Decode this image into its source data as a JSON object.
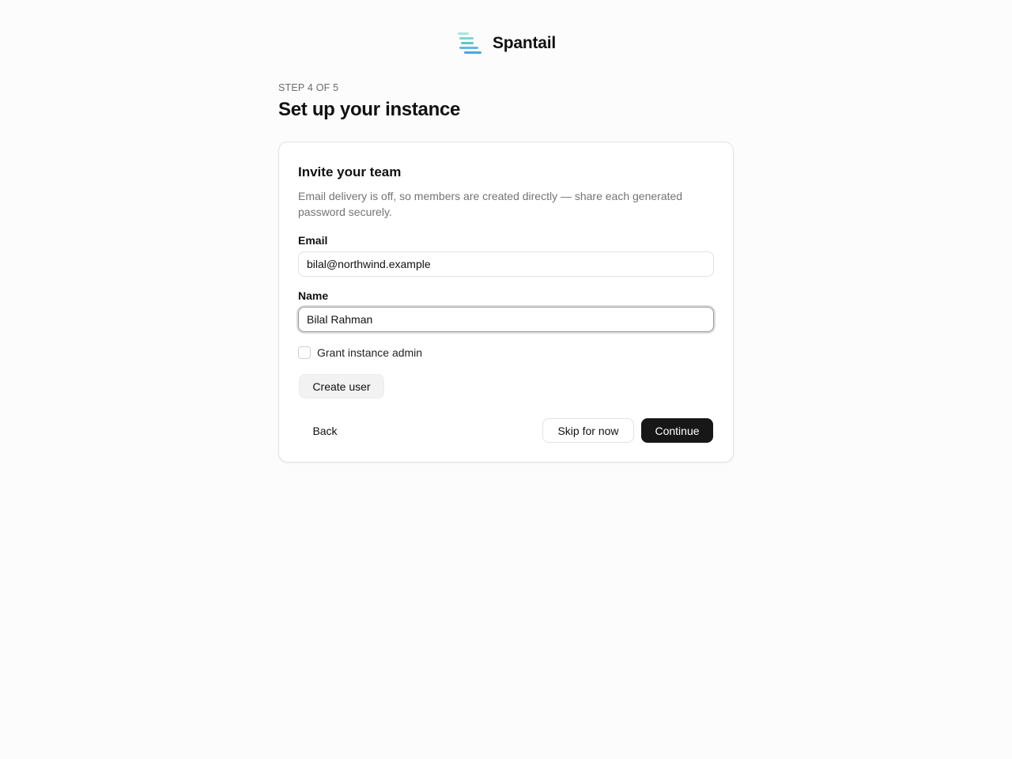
{
  "brand": {
    "name": "Spantail",
    "logo_icon": "stacked-bars-logo-icon",
    "logo_colors": [
      "#a8e4e2",
      "#7fd6d2",
      "#5cc7c3",
      "#67b6e5",
      "#4aa6e0"
    ]
  },
  "wizard": {
    "step_label": "STEP 4 OF 5",
    "title": "Set up your instance"
  },
  "card": {
    "title": "Invite your team",
    "description": "Email delivery is off, so members are created directly — share each generated password securely.",
    "email": {
      "label": "Email",
      "value": "bilal@northwind.example"
    },
    "name": {
      "label": "Name",
      "value": "Bilal Rahman"
    },
    "admin_checkbox": {
      "label": "Grant instance admin",
      "checked": false
    },
    "create_user_label": "Create user"
  },
  "actions": {
    "back_label": "Back",
    "skip_label": "Skip for now",
    "continue_label": "Continue"
  },
  "colors": {
    "background": "#fcfcfc",
    "primary_button": "#171717",
    "muted_text": "#747474"
  }
}
